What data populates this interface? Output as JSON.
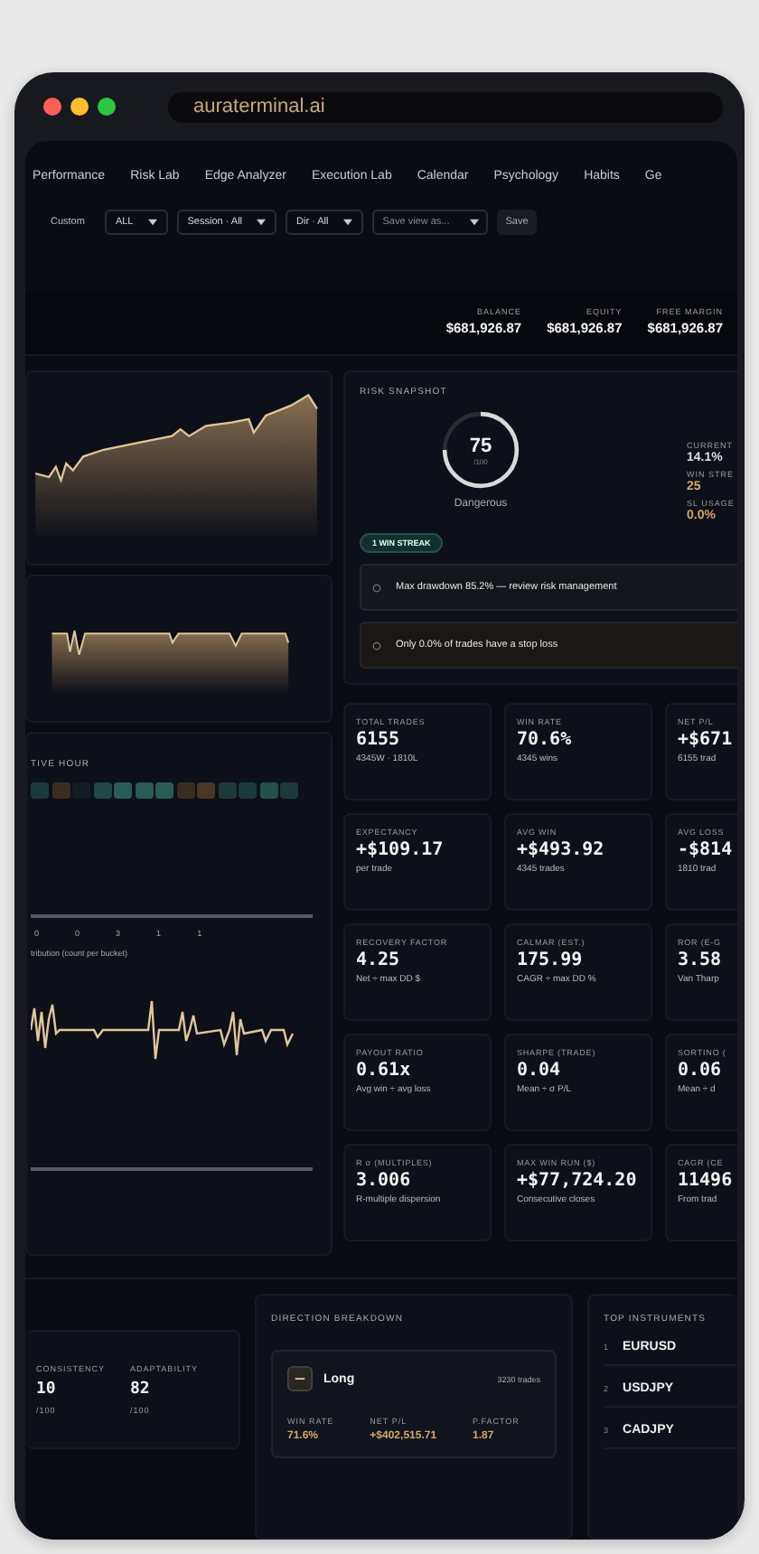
{
  "browser": {
    "url": "auraterminal.ai"
  },
  "tabs": [
    {
      "label": "Performance",
      "selected": false
    },
    {
      "label": "Risk Lab",
      "selected": false
    },
    {
      "label": "Edge Analyzer",
      "selected": false
    },
    {
      "label": "Execution Lab",
      "selected": false
    },
    {
      "label": "Calendar",
      "selected": false
    },
    {
      "label": "Psychology",
      "selected": false
    },
    {
      "label": "Habits",
      "selected": false
    },
    {
      "label": "Ge",
      "selected": false
    }
  ],
  "filters": {
    "range": "Custom",
    "dropdowns": [
      "ALL",
      "Session · All",
      "Dir · All"
    ],
    "save_view": {
      "placeholder": "Save view as..."
    },
    "save_button": "Save"
  },
  "account": [
    {
      "label": "BALANCE",
      "value": "$681,926.87"
    },
    {
      "label": "EQUITY",
      "value": "$681,926.87"
    },
    {
      "label": "FREE MARGIN",
      "value": "$681,926.87"
    }
  ],
  "hour_card": {
    "title": "TIVE HOUR",
    "cells": [
      {
        "color": "#1d3a3a"
      },
      {
        "color": "#3a2c1e"
      },
      {
        "color": "#141c26"
      },
      {
        "color": "#1f4a46"
      },
      {
        "color": "#2a5c56"
      },
      {
        "color": "#2a5c56"
      },
      {
        "color": "#2a5c56"
      },
      {
        "color": "#3a2c1e"
      },
      {
        "color": "#4a3624"
      },
      {
        "color": "#1d3a3a"
      },
      {
        "color": "#1d3a3a"
      },
      {
        "color": "#245048"
      },
      {
        "color": "#1d3a3a"
      }
    ],
    "ticks": [
      "0",
      "0",
      "3",
      "1",
      "1"
    ],
    "dist_title": "tribution (count per bucket)"
  },
  "risk": {
    "title": "RISK SNAPSHOT",
    "score": "75",
    "max": "/100",
    "verdict": "Dangerous",
    "stats": [
      {
        "label": "CURRENT",
        "value": "14.1%",
        "accent": false
      },
      {
        "label": "WIN STRE",
        "value": "25",
        "accent": true
      },
      {
        "label": "SL USAGE",
        "value": "0.0%",
        "accent": true
      }
    ],
    "badge": "1 WIN STREAK",
    "alerts": [
      "Max drawdown 85.2% — review risk management",
      "Only 0.0% of trades have a stop loss"
    ]
  },
  "metrics": [
    {
      "label": "TOTAL TRADES",
      "value": "6155",
      "sub": "4345W · 1810L"
    },
    {
      "label": "WIN RATE",
      "value": "70.6%",
      "sub": "4345 wins"
    },
    {
      "label": "NET P/L",
      "value": "+$671",
      "sub": "6155 trad"
    },
    {
      "label": "EXPECTANCY",
      "value": "+$109.17",
      "sub": "per trade"
    },
    {
      "label": "AVG WIN",
      "value": "+$493.92",
      "sub": "4345 trades"
    },
    {
      "label": "AVG LOSS",
      "value": "-$814",
      "sub": "1810 trad"
    },
    {
      "label": "RECOVERY FACTOR",
      "value": "4.25",
      "sub": "Net ÷ max DD $"
    },
    {
      "label": "CALMAR (EST.)",
      "value": "175.99",
      "sub": "CAGR ÷ max DD %"
    },
    {
      "label": "ROR (E-G",
      "value": "3.58",
      "sub": "Van Tharp"
    },
    {
      "label": "PAYOUT RATIO",
      "value": "0.61x",
      "sub": "Avg win ÷ avg loss"
    },
    {
      "label": "SHARPE (TRADE)",
      "value": "0.04",
      "sub": "Mean ÷ σ P/L"
    },
    {
      "label": "SORTINO (",
      "value": "0.06",
      "sub": "Mean ÷ d"
    },
    {
      "label": "R σ (MULTIPLES)",
      "value": "3.006",
      "sub": "R-multiple dispersion"
    },
    {
      "label": "MAX WIN RUN ($)",
      "value": "+$77,724.20",
      "sub": "Consecutive closes"
    },
    {
      "label": "CAGR (CE",
      "value": "11496",
      "sub": "From trad"
    }
  ],
  "scores": [
    {
      "label": "CONSISTENCY",
      "value": "10",
      "max": "/100"
    },
    {
      "label": "ADAPTABILITY",
      "value": "82",
      "max": "/100"
    }
  ],
  "direction": {
    "title": "DIRECTION BREAKDOWN",
    "name": "Long",
    "trades": "3230 trades",
    "stats": [
      {
        "label": "WIN RATE",
        "value": "71.6%"
      },
      {
        "label": "NET P/L",
        "value": "+$402,515.71"
      },
      {
        "label": "P.FACTOR",
        "value": "1.87"
      }
    ]
  },
  "instruments": {
    "title": "TOP INSTRUMENTS",
    "items": [
      {
        "rank": "1",
        "symbol": "EURUSD"
      },
      {
        "rank": "2",
        "symbol": "USDJPY"
      },
      {
        "rank": "3",
        "symbol": "CADJPY"
      }
    ]
  }
}
